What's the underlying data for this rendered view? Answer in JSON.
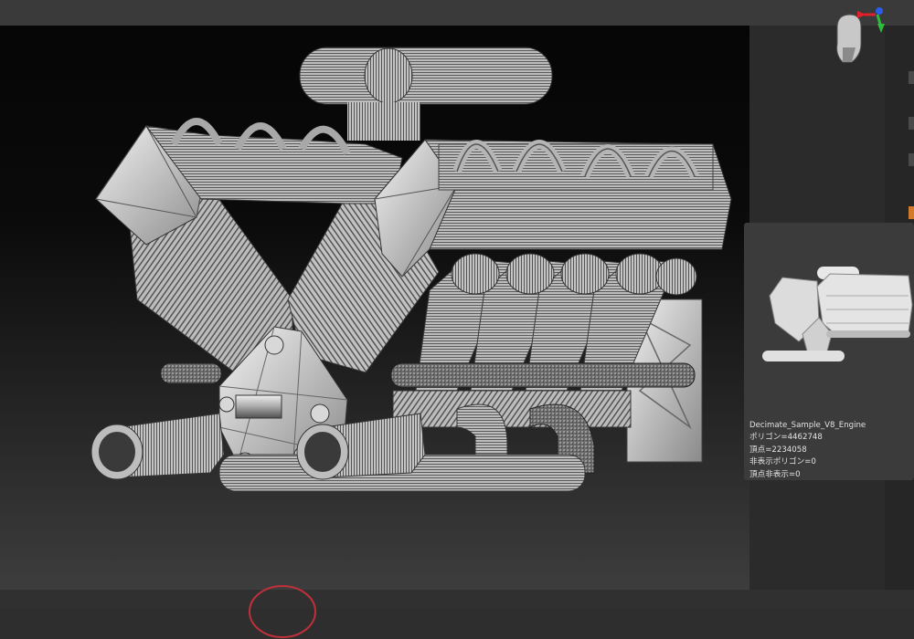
{
  "window": {
    "accent_color": "#d27a2a"
  },
  "viewport": {
    "background_top": "#050505",
    "background_bottom": "#3d3d3d"
  },
  "preview_panel": {
    "mesh_name": "Decimate_Sample_V8_Engine",
    "polygons": "ポリゴン=4462748",
    "vertices": "頂点=2234058",
    "hidden_polygons": "非表示ポリゴン=0",
    "hidden_vertices": "頂点非表示=0"
  },
  "icons": {
    "orientation_gizmo": "head-gizmo-icon",
    "axis_colors": {
      "x": "#e0202a",
      "y": "#2ebd3a",
      "z": "#2a5ee8"
    }
  }
}
